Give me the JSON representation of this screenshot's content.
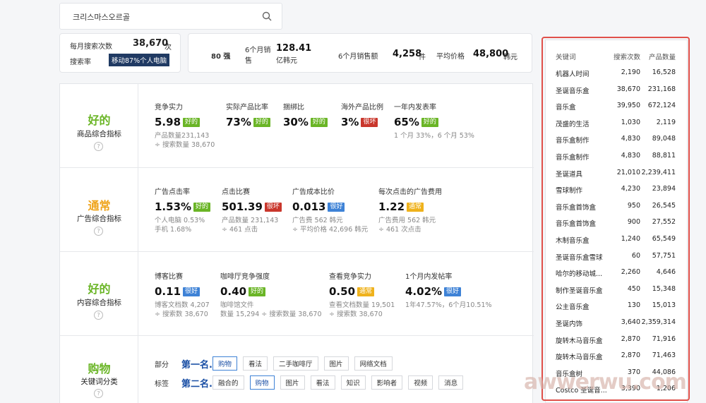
{
  "search": {
    "query": "크리스마스오르골"
  },
  "summary": {
    "monthly_search_label": "每月搜索次数",
    "monthly_search_value": "38,670",
    "monthly_search_unit": "次",
    "search_rate_label": "搜索率",
    "device_badge": "移动87%个人电脑"
  },
  "stats": {
    "rank": "80 强",
    "sales_6m_label": "6个月销售",
    "sales_6m_value": "128.41",
    "sales_6m_unit": "亿韩元",
    "sales_count_label": "6个月销售额",
    "sales_count_value": "4,258",
    "sales_count_unit": "件",
    "avg_price_label": "平均价格",
    "avg_price_value": "48,800",
    "avg_price_unit": "韩元"
  },
  "sections": {
    "product": {
      "grade": "好的",
      "title": "商品综合指标",
      "metrics": [
        {
          "label": "竞争实力",
          "value": "5.98",
          "badge": "好的",
          "sub1": "产品数量231,143",
          "sub2": "÷ 搜索数量 38,670"
        },
        {
          "label": "实际产品比率",
          "value": "73%",
          "badge": "好的"
        },
        {
          "label": "捆绑比",
          "value": "30%",
          "badge": "好的"
        },
        {
          "label": "海外产品比例",
          "value": "3%",
          "badge": "很坏"
        },
        {
          "label": "一年内发表率",
          "value": "65%",
          "badge": "好的",
          "sub1": "1 个月 33%，6 个月 53%"
        }
      ]
    },
    "ads": {
      "grade": "通常",
      "title": "广告综合指标",
      "metrics": [
        {
          "label": "广告点击率",
          "value": "1.53%",
          "badge": "好的",
          "sub1": "个人电脑 0.53%",
          "sub2": "手机 1.68%"
        },
        {
          "label": "点击比赛",
          "value": "501.39",
          "badge": "很坏",
          "sub1": "产品数量 231,143",
          "sub2": "÷ 461 点击"
        },
        {
          "label": "广告成本比价",
          "value": "0.013",
          "badge": "很好",
          "sub1": "广告费 562 韩元",
          "sub2": "÷ 平均价格 42,696 韩元"
        },
        {
          "label": "每次点击的广告费用",
          "value": "1.22",
          "badge": "通常",
          "sub1": "广告费用 562 韩元",
          "sub2": "÷ 461 次点击"
        }
      ]
    },
    "content": {
      "grade": "好的",
      "title": "内容综合指标",
      "metrics": [
        {
          "label": "博客比赛",
          "value": "0.11",
          "badge": "很好",
          "sub1": "博客文档数 4,207",
          "sub2": "÷ 搜索数 38,670"
        },
        {
          "label": "咖啡厅竞争强度",
          "value": "0.40",
          "badge": "好的",
          "sub1": "咖啡馆文件",
          "sub2": "数量 15,294 ÷ 搜索数量 38,670"
        },
        {
          "label": "查看竞争实力",
          "value": "0.50",
          "badge": "通常",
          "sub1": "查看文档数量 19,501",
          "sub2": "÷ 搜索数 38,670"
        },
        {
          "label": "1个月内发帖率",
          "value": "4.02%",
          "badge": "很好",
          "sub1": "1年47.57%，6个月10.51%"
        }
      ]
    },
    "shopping": {
      "grade": "购物",
      "title": "关键词分类",
      "row1_label": "部分",
      "row1_rank": "第一名...",
      "row1_chips": [
        "购物",
        "看法",
        "二手咖啡厅",
        "图片",
        "网络文档"
      ],
      "row2_label": "标签",
      "row2_rank": "第二名...",
      "row2_chips": [
        "融合的",
        "购物",
        "图片",
        "看法",
        "知识",
        "影响者",
        "视频",
        "消息"
      ]
    }
  },
  "keywords": {
    "headers": [
      "关键词",
      "搜索次数",
      "产品数量"
    ],
    "rows": [
      [
        "机器人时间",
        "2,190",
        "16,528"
      ],
      [
        "圣诞音乐盒",
        "38,670",
        "231,168"
      ],
      [
        "音乐盒",
        "39,950",
        "672,124"
      ],
      [
        "茂盛的生活",
        "1,030",
        "2,119"
      ],
      [
        "音乐盒制作",
        "4,830",
        "89,048"
      ],
      [
        "音乐盒制作",
        "4,830",
        "88,811"
      ],
      [
        "圣诞道具",
        "21,010",
        "2,239,411"
      ],
      [
        "雪球制作",
        "4,230",
        "23,894"
      ],
      [
        "音乐盒首饰盒",
        "950",
        "26,545"
      ],
      [
        "音乐盒首饰盒",
        "900",
        "27,552"
      ],
      [
        "木制音乐盒",
        "1,240",
        "65,549"
      ],
      [
        "圣诞音乐盒雪球",
        "60",
        "57,751"
      ],
      [
        "哈尔的移动城...",
        "2,260",
        "4,646"
      ],
      [
        "制作圣诞音乐盒",
        "450",
        "15,348"
      ],
      [
        "公主音乐盒",
        "130",
        "15,013"
      ],
      [
        "圣诞内饰",
        "3,640",
        "2,359,314"
      ],
      [
        "旋转木马音乐盒",
        "2,870",
        "71,916"
      ],
      [
        "旋转木马音乐盒",
        "2,870",
        "71,463"
      ],
      [
        "音乐盒树",
        "370",
        "44,086"
      ],
      [
        "Costco 圣诞音...",
        "3,390",
        "1,206"
      ]
    ]
  },
  "watermark": "awwerwu.com"
}
